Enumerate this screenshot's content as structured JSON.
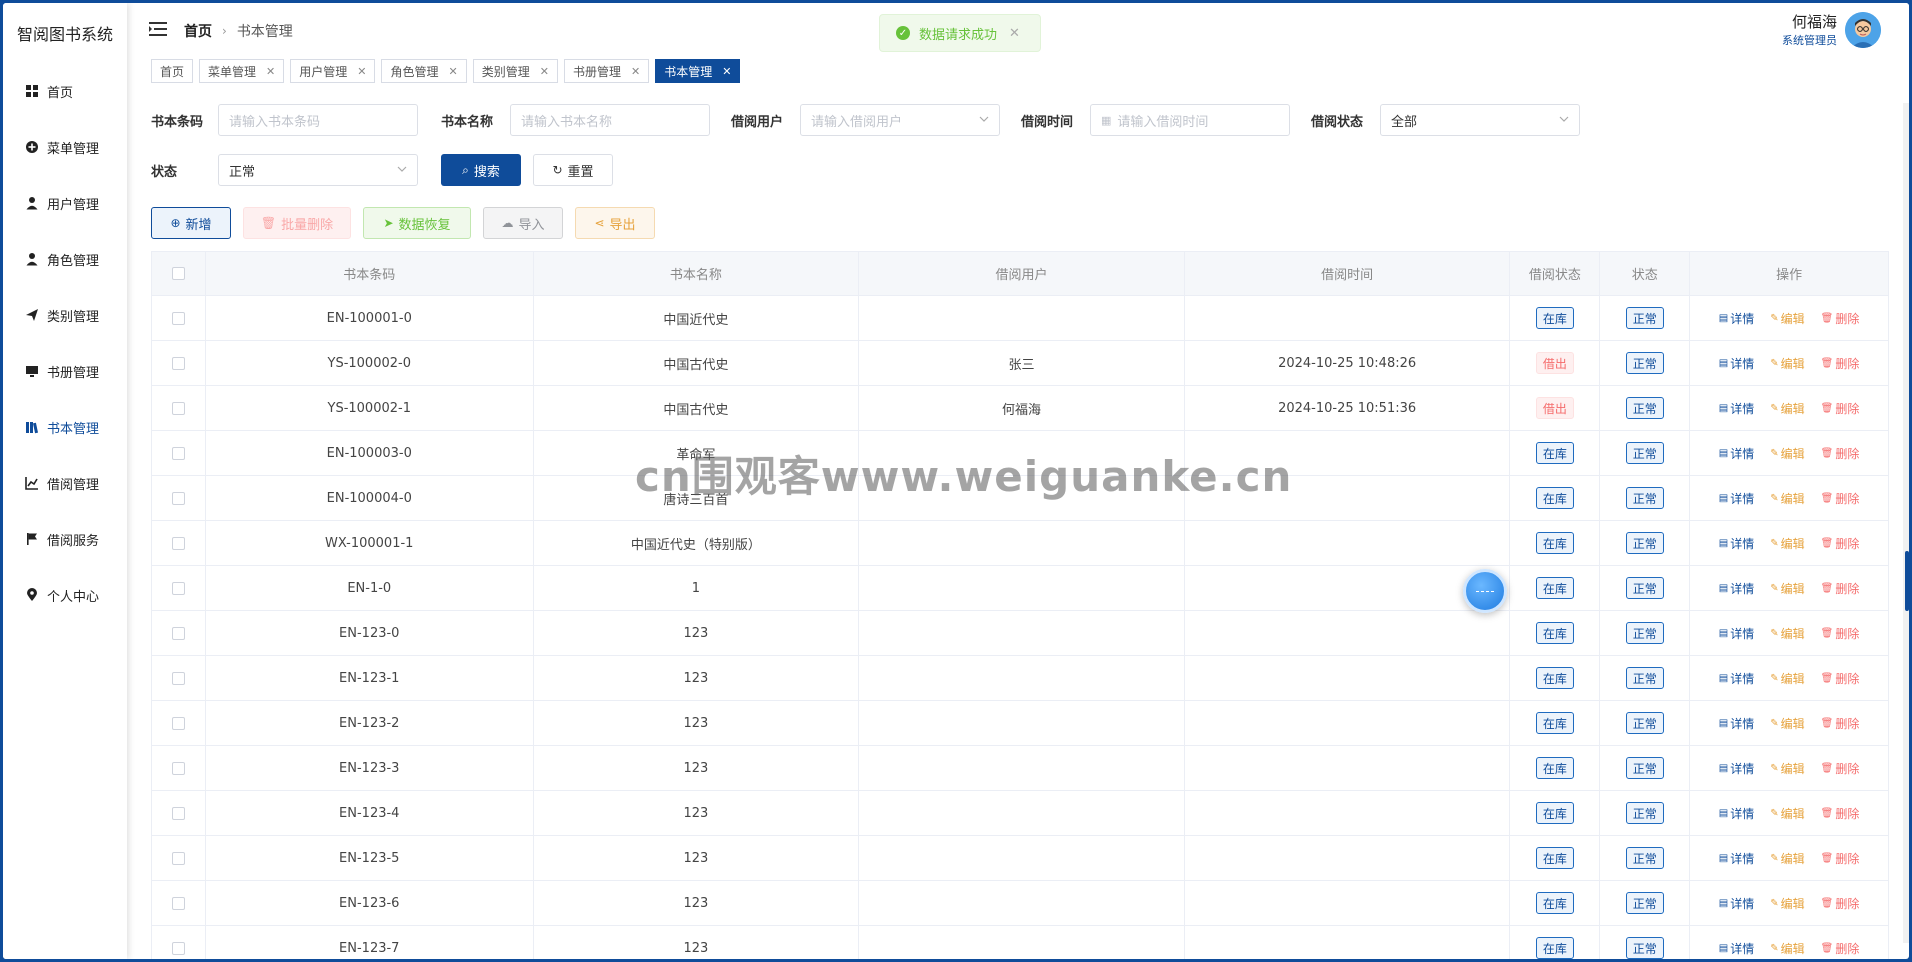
{
  "app": {
    "title": "智阅图书系统"
  },
  "sidebar": {
    "items": [
      {
        "label": "首页",
        "icon": "grid-icon"
      },
      {
        "label": "菜单管理",
        "icon": "plus-circle-icon"
      },
      {
        "label": "用户管理",
        "icon": "user-icon"
      },
      {
        "label": "角色管理",
        "icon": "user-role-icon"
      },
      {
        "label": "类别管理",
        "icon": "send-icon"
      },
      {
        "label": "书册管理",
        "icon": "monitor-icon"
      },
      {
        "label": "书本管理",
        "icon": "books-icon",
        "active": true
      },
      {
        "label": "借阅管理",
        "icon": "chart-icon"
      },
      {
        "label": "借阅服务",
        "icon": "flag-icon"
      },
      {
        "label": "个人中心",
        "icon": "location-icon"
      }
    ]
  },
  "header": {
    "breadcrumb": {
      "home": "首页",
      "current": "书本管理"
    },
    "toast": {
      "message": "数据请求成功"
    },
    "user": {
      "name": "何福海",
      "role": "系统管理员"
    }
  },
  "tags": [
    {
      "label": "首页",
      "closable": false
    },
    {
      "label": "菜单管理",
      "closable": true
    },
    {
      "label": "用户管理",
      "closable": true
    },
    {
      "label": "角色管理",
      "closable": true
    },
    {
      "label": "类别管理",
      "closable": true
    },
    {
      "label": "书册管理",
      "closable": true
    },
    {
      "label": "书本管理",
      "closable": true,
      "active": true
    }
  ],
  "search": {
    "barcode": {
      "label": "书本条码",
      "placeholder": "请输入书本条码"
    },
    "name": {
      "label": "书本名称",
      "placeholder": "请输入书本名称"
    },
    "borrower": {
      "label": "借阅用户",
      "placeholder": "请输入借阅用户"
    },
    "borrow_time": {
      "label": "借阅时间",
      "placeholder": "请输入借阅时间"
    },
    "borrow_status": {
      "label": "借阅状态",
      "value": "全部"
    },
    "status": {
      "label": "状态",
      "value": "正常"
    },
    "search_button": "搜索",
    "reset_button": "重置"
  },
  "toolbar": {
    "add": "新增",
    "batch_delete": "批量删除",
    "restore": "数据恢复",
    "import": "导入",
    "export": "导出"
  },
  "table": {
    "columns": [
      "书本条码",
      "书本名称",
      "借阅用户",
      "借阅时间",
      "借阅状态",
      "状态",
      "操作"
    ],
    "actions": {
      "detail": "详情",
      "edit": "编辑",
      "delete": "删除"
    },
    "rows": [
      {
        "barcode": "EN-100001-0",
        "name": "中国近代史",
        "borrower": "",
        "time": "",
        "borrow_status": "在库",
        "status": "正常"
      },
      {
        "barcode": "YS-100002-0",
        "name": "中国古代史",
        "borrower": "张三",
        "time": "2024-10-25 10:48:26",
        "borrow_status": "借出",
        "status": "正常"
      },
      {
        "barcode": "YS-100002-1",
        "name": "中国古代史",
        "borrower": "何福海",
        "time": "2024-10-25 10:51:36",
        "borrow_status": "借出",
        "status": "正常"
      },
      {
        "barcode": "EN-100003-0",
        "name": "革命军",
        "borrower": "",
        "time": "",
        "borrow_status": "在库",
        "status": "正常"
      },
      {
        "barcode": "EN-100004-0",
        "name": "唐诗三百首",
        "borrower": "",
        "time": "",
        "borrow_status": "在库",
        "status": "正常"
      },
      {
        "barcode": "WX-100001-1",
        "name": "中国近代史（特别版）",
        "borrower": "",
        "time": "",
        "borrow_status": "在库",
        "status": "正常"
      },
      {
        "barcode": "EN-1-0",
        "name": "1",
        "borrower": "",
        "time": "",
        "borrow_status": "在库",
        "status": "正常"
      },
      {
        "barcode": "EN-123-0",
        "name": "123",
        "borrower": "",
        "time": "",
        "borrow_status": "在库",
        "status": "正常"
      },
      {
        "barcode": "EN-123-1",
        "name": "123",
        "borrower": "",
        "time": "",
        "borrow_status": "在库",
        "status": "正常"
      },
      {
        "barcode": "EN-123-2",
        "name": "123",
        "borrower": "",
        "time": "",
        "borrow_status": "在库",
        "status": "正常"
      },
      {
        "barcode": "EN-123-3",
        "name": "123",
        "borrower": "",
        "time": "",
        "borrow_status": "在库",
        "status": "正常"
      },
      {
        "barcode": "EN-123-4",
        "name": "123",
        "borrower": "",
        "time": "",
        "borrow_status": "在库",
        "status": "正常"
      },
      {
        "barcode": "EN-123-5",
        "name": "123",
        "borrower": "",
        "time": "",
        "borrow_status": "在库",
        "status": "正常"
      },
      {
        "barcode": "EN-123-6",
        "name": "123",
        "borrower": "",
        "time": "",
        "borrow_status": "在库",
        "status": "正常"
      },
      {
        "barcode": "EN-123-7",
        "name": "123",
        "borrower": "",
        "time": "",
        "borrow_status": "在库",
        "status": "正常"
      }
    ]
  },
  "watermark": "cn围观客www.weiguanke.cn",
  "colors": {
    "primary": "#0f4c9a",
    "success": "#67c23a",
    "danger": "#f56c6c",
    "warning": "#e6a23c"
  }
}
